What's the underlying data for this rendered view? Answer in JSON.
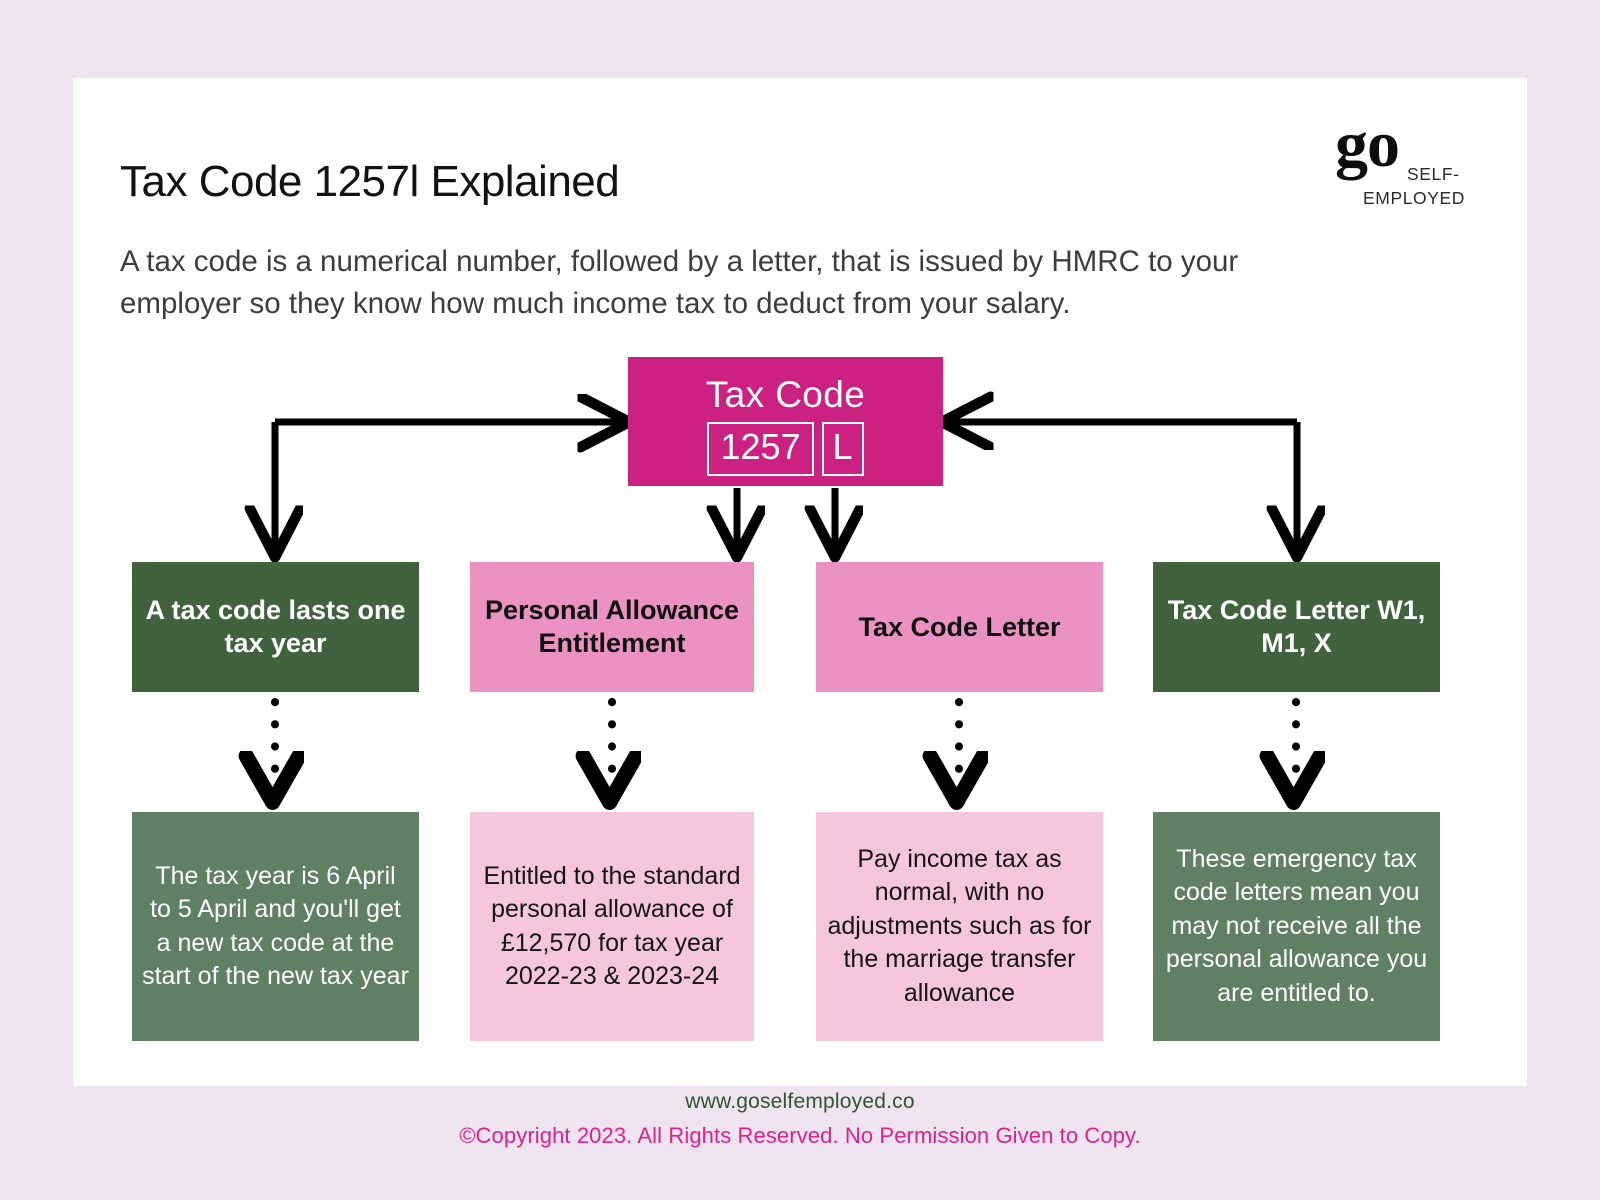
{
  "background_color": "#efe4f0",
  "card_color": "#ffffff",
  "header": {
    "title": "Tax Code 1257l Explained",
    "intro": "A tax code is a numerical number, followed by a letter, that is issued by HMRC to your employer so they know how much income tax to deduct from your salary."
  },
  "logo": {
    "wordmark": "go",
    "line1": "SELF-",
    "line2": "EMPLOYED"
  },
  "diagram": {
    "root": {
      "label": "Tax Code",
      "number": "1257",
      "letter": "L",
      "color": "#cc2083"
    },
    "categories": [
      {
        "label": "A tax code lasts one tax year",
        "color": "#40633e",
        "text_color": "#ffffff"
      },
      {
        "label": "Personal Allowance Entitlement",
        "color": "#ec92c3",
        "text_color": "#101010"
      },
      {
        "label": "Tax Code Letter",
        "color": "#ec92c3",
        "text_color": "#101010"
      },
      {
        "label": "Tax Code Letter W1, M1, X",
        "color": "#40633e",
        "text_color": "#ffffff"
      }
    ],
    "details": [
      {
        "text": "The tax year is 6 April to 5 April and you'll get a new tax code at the start of the new tax year",
        "color": "#5f8063",
        "text_color": "#ffffff"
      },
      {
        "text": "Entitled to the standard personal allowance of £12,570 for tax year 2022-23 & 2023-24",
        "color": "#f6c5de",
        "text_color": "#141414"
      },
      {
        "text": "Pay income tax as normal, with no adjustments such as for the marriage transfer allowance",
        "color": "#f6c5de",
        "text_color": "#141414"
      },
      {
        "text": "These emergency tax code letters mean you may not receive all the personal allowance you are entitled to.",
        "color": "#5f8063",
        "text_color": "#ffffff"
      }
    ]
  },
  "footer": {
    "url": "www.goselfemployed.co",
    "copyright": "©Copyright 2023. All Rights Reserved. No Permission Given to Copy.",
    "url_color": "#2f5631",
    "copyright_color": "#e0218a"
  }
}
